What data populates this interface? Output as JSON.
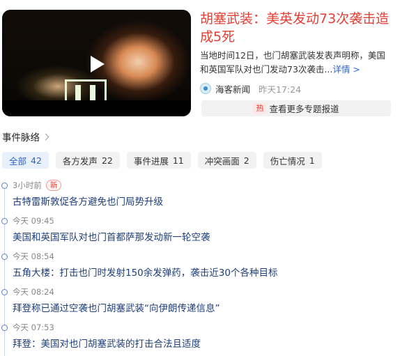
{
  "article": {
    "headline": "胡塞武装：美英发动73次袭击造成5死",
    "summary": "当地时间12日，也门胡塞武装发表声明称，美国和英国军队对也门发动73次袭击...",
    "more_link": "详情 >",
    "source_icon": "globe-logo-icon",
    "source": "海客新闻",
    "time": "昨天17:24",
    "hot_badge": "热",
    "topic_link": "查看更多专题报道"
  },
  "section": {
    "title": "事件脉络"
  },
  "filters": [
    {
      "label": "全部",
      "count": "42",
      "active": true
    },
    {
      "label": "各方发声",
      "count": "22",
      "active": false
    },
    {
      "label": "事件进展",
      "count": "11",
      "active": false
    },
    {
      "label": "冲突画面",
      "count": "2",
      "active": false
    },
    {
      "label": "伤亡情况",
      "count": "1",
      "active": false
    }
  ],
  "timeline": [
    {
      "time": "3小时前",
      "badge": "新",
      "text": "古特雷斯敦促各方避免也门局势升级"
    },
    {
      "time": "今天 09:45",
      "badge": "",
      "text": "美国和英国军队对也门首都萨那发动新一轮空袭"
    },
    {
      "time": "今天 08:54",
      "badge": "",
      "text": "五角大楼：打击也门时发射150余发弹药，袭击近30个各种目标"
    },
    {
      "time": "今天 08:24",
      "badge": "",
      "text": "拜登称已通过空袭也门胡塞武装“向伊朗传递信息”"
    },
    {
      "time": "今天 07:53",
      "badge": "",
      "text": "拜登：美国对也门胡塞武装的打击合法且适度"
    }
  ],
  "colors": {
    "accent_red": "#e33e33",
    "link_blue": "#2f64c8",
    "timeline_text": "#1f3e7a"
  }
}
